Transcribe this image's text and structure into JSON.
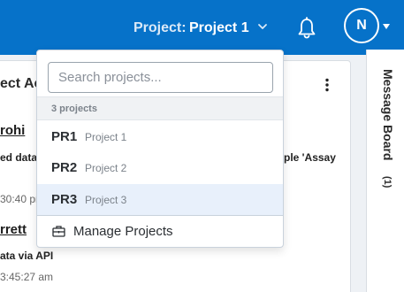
{
  "header": {
    "project_label": "Project:",
    "project_name": "Project 1",
    "avatar_initial": "N",
    "bg_color": "#0672c9"
  },
  "activity": {
    "title": "ect Ac",
    "entries": [
      {
        "name": "rohi",
        "desc": "ed data",
        "desc_tail": "ple 'Assay",
        "time": "30:40 pr"
      },
      {
        "name": "rrett",
        "desc": "ata via API",
        "time": "3:45:27 am"
      }
    ]
  },
  "message_board": {
    "label": "Message Board",
    "count": "(1)"
  },
  "dropdown": {
    "search_placeholder": "Search projects...",
    "count_text": "3 projects",
    "projects": [
      {
        "code": "PR1",
        "name": "Project 1",
        "selected": false
      },
      {
        "code": "PR2",
        "name": "Project 2",
        "selected": false
      },
      {
        "code": "PR3",
        "name": "Project 3",
        "selected": true
      }
    ],
    "manage_label": "Manage Projects"
  }
}
